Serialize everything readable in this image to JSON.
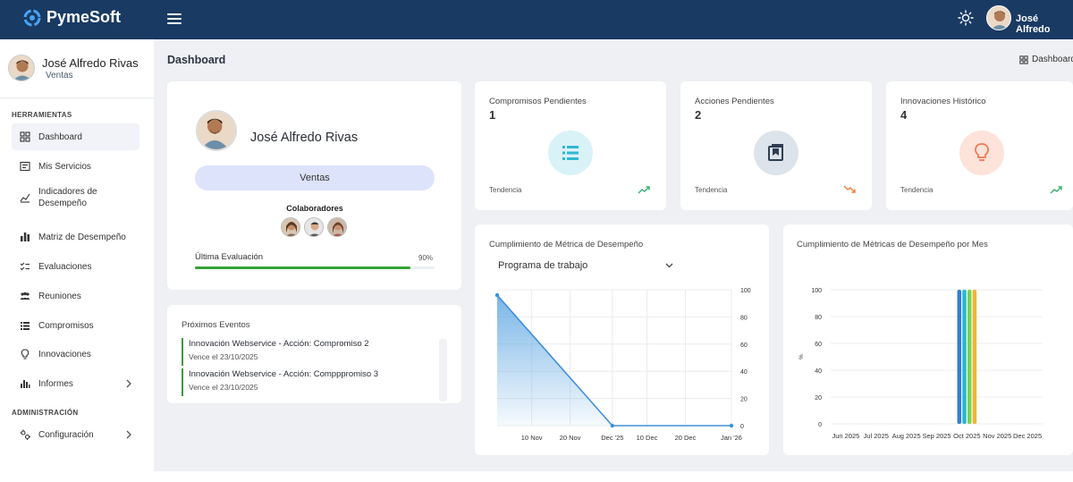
{
  "app": {
    "brand": "PymeSoft",
    "user_short": "José Alfredo"
  },
  "sidebar": {
    "user_name": "José Alfredo Rivas",
    "user_role": "Ventas",
    "sections": [
      "HERRAMIENTAS",
      "ADMINISTRACIÓN"
    ],
    "items": [
      {
        "label": "Dashboard",
        "icon": "dashboard-icon",
        "active": true
      },
      {
        "label": "Mis Servicios",
        "icon": "services-icon"
      },
      {
        "label": "Indicadores de Desempeño",
        "icon": "indicators-icon"
      },
      {
        "label": "Matriz de Desempeño",
        "icon": "matrix-icon"
      },
      {
        "label": "Evaluaciones",
        "icon": "evaluations-icon"
      },
      {
        "label": "Reuniones",
        "icon": "meetings-icon"
      },
      {
        "label": "Compromisos",
        "icon": "commitments-icon"
      },
      {
        "label": "Innovaciones",
        "icon": "innovations-icon"
      },
      {
        "label": "Informes",
        "icon": "reports-icon",
        "expandable": true
      },
      {
        "label": "Configuración",
        "icon": "settings-icon",
        "expandable": true
      }
    ]
  },
  "header": {
    "title": "Dashboard",
    "breadcrumb": "Dashboard"
  },
  "profile_card": {
    "name": "José Alfredo Rivas",
    "department": "Ventas",
    "collaborators_label": "Colaboradores",
    "collaborators_count": 3,
    "last_eval_label": "Última Evaluación",
    "last_eval_value": "90%",
    "last_eval_fraction": 0.9
  },
  "events": {
    "title": "Próximos Eventos",
    "items": [
      {
        "title": "Innovación Webservice - Acción: Compromiso 2",
        "due": "Vence el 23/10/2025"
      },
      {
        "title": "Innovación Webservice - Acción: Compppromiso 3",
        "due": "Vence el 23/10/2025"
      }
    ]
  },
  "kpis": [
    {
      "title": "Compromisos Pendientes",
      "value": "1",
      "trend_label": "Tendencia",
      "trend": "up",
      "icon": "list-icon",
      "circle_color": "#d8f2f7",
      "icon_color": "#31b7d1",
      "trend_color": "#2fb36a"
    },
    {
      "title": "Acciones Pendientes",
      "value": "2",
      "trend_label": "Tendencia",
      "trend": "down",
      "icon": "bookmark-icon",
      "circle_color": "#dde3ea",
      "icon_color": "#2f3d52",
      "trend_color": "#f07c3b"
    },
    {
      "title": "Innovaciones Histórico",
      "value": "4",
      "trend_label": "Tendencia",
      "trend": "up",
      "icon": "lightbulb-icon",
      "circle_color": "#fde3da",
      "icon_color": "#ef7a54",
      "trend_color": "#2fb36a"
    }
  ],
  "line_chart_card": {
    "title": "Cumplimiento de Métrica de Desempeño",
    "selected": "Programa de trabajo"
  },
  "bar_chart_card": {
    "title": "Cumplimiento de Métricas de Desempeño por Mes"
  },
  "chart_data": [
    {
      "type": "area",
      "title": "Cumplimiento de Métrica de Desempeño",
      "x_ticks": [
        "10 Nov",
        "20 Nov",
        "Dec '25",
        "10 Dec",
        "20 Dec",
        "Jan '26"
      ],
      "y_ticks": [
        0,
        20,
        40,
        60,
        80,
        100
      ],
      "ylim": [
        0,
        100
      ],
      "axis_position": "right",
      "points": [
        {
          "x": "2025-11-01",
          "y": 96
        },
        {
          "x": "2025-12-01",
          "y": 0
        },
        {
          "x": "2026-01-01",
          "y": 0
        }
      ],
      "color": "#3f8fdc"
    },
    {
      "type": "bar",
      "title": "Cumplimiento de Métricas de Desempeño por Mes",
      "categories": [
        "Jun 2025",
        "Jul 2025",
        "Aug 2025",
        "Sep 2025",
        "Oct 2025",
        "Nov 2025",
        "Dec 2025"
      ],
      "ylabel": "%",
      "y_ticks": [
        0,
        20,
        40,
        60,
        80,
        100
      ],
      "ylim": [
        0,
        100
      ],
      "series": [
        {
          "values": [
            0,
            0,
            0,
            0,
            100,
            0,
            0
          ],
          "color": "#2f7ed8"
        },
        {
          "values": [
            0,
            0,
            0,
            0,
            100,
            0,
            0
          ],
          "color": "#29b6d8"
        },
        {
          "values": [
            0,
            0,
            0,
            0,
            100,
            0,
            0
          ],
          "color": "#7fce55"
        },
        {
          "values": [
            0,
            0,
            0,
            0,
            100,
            0,
            0
          ],
          "color": "#f0b52f"
        }
      ]
    }
  ]
}
